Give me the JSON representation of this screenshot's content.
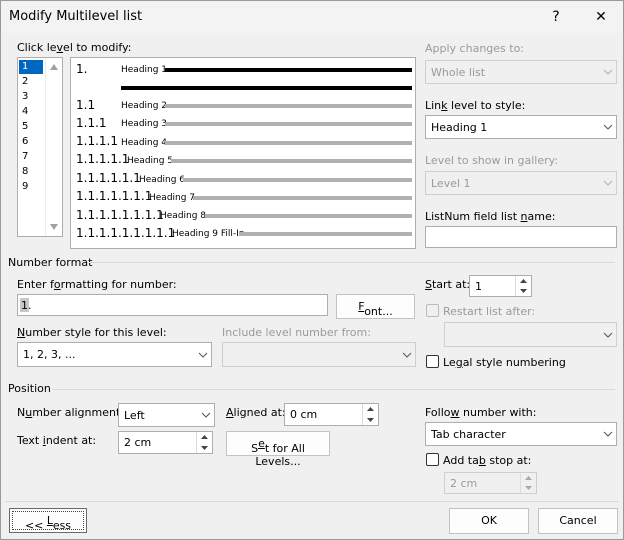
{
  "dialog": {
    "title": "Modify Multilevel list",
    "help_label": "?",
    "close_label": "✕"
  },
  "levels": {
    "label_pre": "Click le",
    "label_u": "v",
    "label_post": "el to modify:",
    "items": [
      "1",
      "2",
      "3",
      "4",
      "5",
      "6",
      "7",
      "8",
      "9"
    ],
    "selected": "1"
  },
  "preview": {
    "rows": [
      {
        "num": "1.",
        "heading": "Heading 1",
        "bold": true
      },
      {
        "num": "1.1",
        "heading": "Heading 2"
      },
      {
        "num": "1.1.1",
        "heading": "Heading 3"
      },
      {
        "num": "1.1.1.1",
        "heading": "Heading 4"
      },
      {
        "num": "1.1.1.1.1",
        "heading": "Heading 5"
      },
      {
        "num": "1.1.1.1.1.1",
        "heading": "Heading 6"
      },
      {
        "num": "1.1.1.1.1.1.1",
        "heading": "Heading 7"
      },
      {
        "num": "1.1.1.1.1.1.1.1",
        "heading": "Heading 8"
      },
      {
        "num": "1.1.1.1.1.1.1.1.1",
        "heading": "Heading 9 Fill-In"
      }
    ]
  },
  "apply": {
    "label": "Apply changes to:",
    "value": "Whole list"
  },
  "link": {
    "label_pre": "Lin",
    "label_u": "k",
    "label_post": " level to style:",
    "value": "Heading 1"
  },
  "gallery": {
    "label": "Level to show in gallery:",
    "value": "Level 1"
  },
  "listnum": {
    "label_pre": "ListNum field list ",
    "label_u": "n",
    "label_post": "ame:",
    "value": ""
  },
  "number_format": {
    "section_label": "Number format",
    "enter_label_pre": "Enter f",
    "enter_label_u": "o",
    "enter_label_post": "rmatting for number:",
    "format_value": "1.",
    "font_button_u": "F",
    "font_button_post": "ont...",
    "style_label_u": "N",
    "style_label_post": "umber style for this level:",
    "style_value": "1, 2, 3, ...",
    "include_label": "Include level number from:",
    "include_value": "",
    "start_label_pre": "",
    "start_label_u": "S",
    "start_label_post": "tart at:",
    "start_value": "1",
    "restart_label": "Restart list after:",
    "restart_value": "",
    "legal_label_pre": "Le",
    "legal_label_u": "g",
    "legal_label_post": "al style numbering"
  },
  "position": {
    "section_label": "Position",
    "alignment_label_pre": "N",
    "alignment_label_u": "u",
    "alignment_label_post": "mber alignment:",
    "alignment_value": "Left",
    "aligned_label_u": "A",
    "aligned_label_post": "ligned at:",
    "aligned_value": "0 cm",
    "indent_label_pre": "Text ",
    "indent_label_u": "i",
    "indent_label_post": "ndent at:",
    "indent_value": "2 cm",
    "set_all_pre": "S",
    "set_all_u": "e",
    "set_all_post": "t for All Levels...",
    "follow_label_pre": "Follo",
    "follow_label_u": "w",
    "follow_label_post": " number with:",
    "follow_value": "Tab character",
    "tabstop_label_pre": "Add ta",
    "tabstop_label_u": "b",
    "tabstop_label_post": " stop at:",
    "tabstop_value": "2 cm"
  },
  "footer": {
    "less_pre": "<< ",
    "less_u": "L",
    "less_post": "ess",
    "ok_label": "OK",
    "cancel_label": "Cancel"
  }
}
